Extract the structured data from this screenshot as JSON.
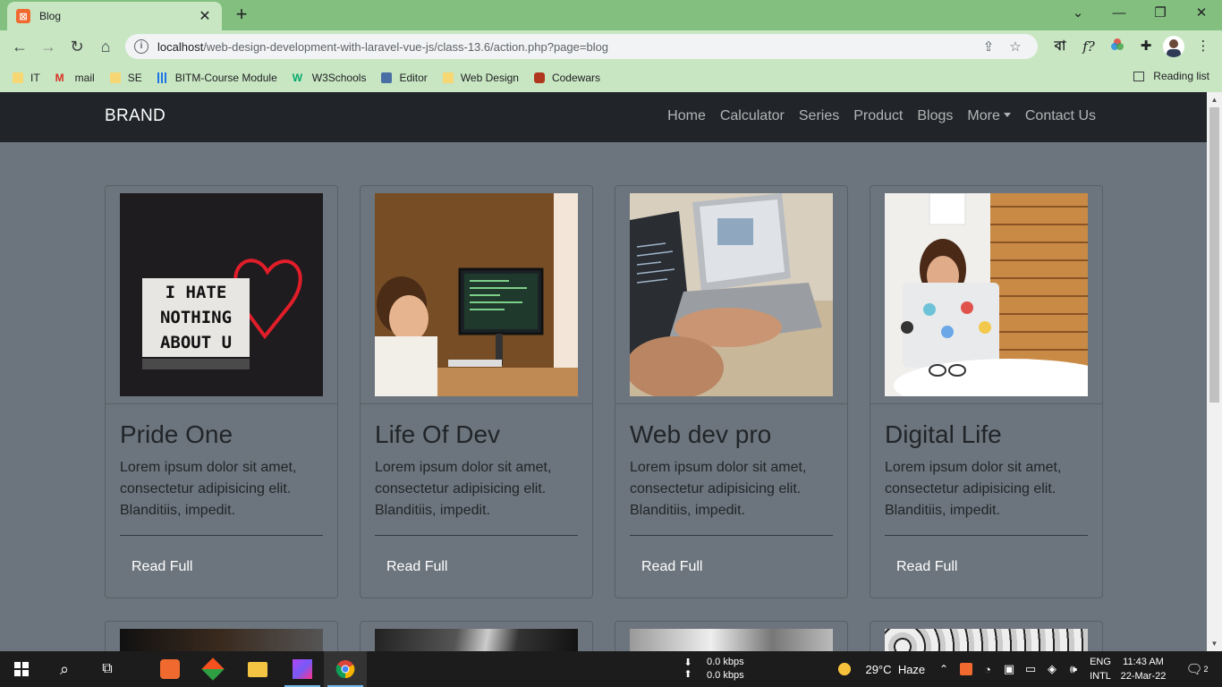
{
  "browser": {
    "tab_title": "Blog",
    "url_host": "localhost",
    "url_path": "/web-design-development-with-laravel-vue-js/class-13.6/action.php?page=blog",
    "ext_bangla": "বা",
    "ext_formula": "f?",
    "bookmarks": [
      "IT",
      "mail",
      "SE",
      "BITM-Course Module",
      "W3Schools",
      "Editor",
      "Web Design",
      "Codewars"
    ],
    "reading_list": "Reading list"
  },
  "navbar": {
    "brand": "BRAND",
    "links": [
      "Home",
      "Calculator",
      "Series",
      "Product",
      "Blogs",
      "More",
      "Contact Us"
    ]
  },
  "cards": [
    {
      "title": "Pride One",
      "text": "Lorem ipsum dolor sit amet, consectetur adipisicing elit. Blanditiis, impedit.",
      "button": "Read Full",
      "img_text": [
        "I HATE",
        "NOTHING",
        "ABOUT U"
      ]
    },
    {
      "title": "Life Of Dev",
      "text": "Lorem ipsum dolor sit amet, consectetur adipisicing elit. Blanditiis, impedit.",
      "button": "Read Full"
    },
    {
      "title": "Web dev pro",
      "text": "Lorem ipsum dolor sit amet, consectetur adipisicing elit. Blanditiis, impedit.",
      "button": "Read Full"
    },
    {
      "title": "Digital Life",
      "text": "Lorem ipsum dolor sit amet, consectetur adipisicing elit. Blanditiis, impedit.",
      "button": "Read Full"
    }
  ],
  "taskbar": {
    "net_down": "0.0 kbps",
    "net_up": "0.0 kbps",
    "temperature": "29°C",
    "weather": "Haze",
    "lang1": "ENG",
    "lang2": "INTL",
    "time": "11:43 AM",
    "date": "22-Mar-22",
    "notifications": "2"
  },
  "colors": {
    "chrome_frame": "#83c07f",
    "chrome_toolbar": "#c8e6c2",
    "navbar_bg": "#212529",
    "page_bg": "#6c757d"
  }
}
